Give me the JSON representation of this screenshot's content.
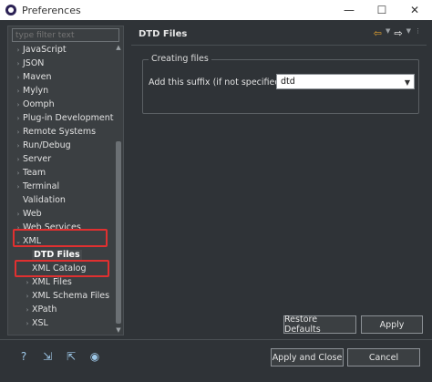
{
  "window": {
    "title": "Preferences",
    "minimize": "—",
    "maximize": "☐",
    "close": "✕"
  },
  "filter": {
    "placeholder": "type filter text"
  },
  "tree": {
    "items": [
      {
        "label": "JavaScript",
        "caret": "›"
      },
      {
        "label": "JSON",
        "caret": "›"
      },
      {
        "label": "Maven",
        "caret": "›"
      },
      {
        "label": "Mylyn",
        "caret": "›"
      },
      {
        "label": "Oomph",
        "caret": "›"
      },
      {
        "label": "Plug-in Development",
        "caret": "›"
      },
      {
        "label": "Remote Systems",
        "caret": "›"
      },
      {
        "label": "Run/Debug",
        "caret": "›"
      },
      {
        "label": "Server",
        "caret": "›"
      },
      {
        "label": "Team",
        "caret": "›"
      },
      {
        "label": "Terminal",
        "caret": "›"
      },
      {
        "label": "Validation",
        "caret": ""
      },
      {
        "label": "Web",
        "caret": "›"
      },
      {
        "label": "Web Services",
        "caret": "›"
      },
      {
        "label": "XML",
        "caret": "⌄"
      },
      {
        "label": "DTD Files",
        "caret": "",
        "child": true,
        "selected": true
      },
      {
        "label": "XML Catalog",
        "caret": "",
        "child": true
      },
      {
        "label": "XML Files",
        "caret": "›",
        "child": true
      },
      {
        "label": "XML Schema Files",
        "caret": "›",
        "child": true
      },
      {
        "label": "XPath",
        "caret": "›",
        "child": true
      },
      {
        "label": "XSL",
        "caret": "›",
        "child": true
      }
    ]
  },
  "page": {
    "title": "DTD Files",
    "group_label": "Creating files",
    "suffix_label": "Add this suffix (if not specified):",
    "suffix_value": "dtd"
  },
  "buttons": {
    "restore_defaults": "Restore Defaults",
    "apply": "Apply",
    "apply_and_close": "Apply and Close",
    "cancel": "Cancel"
  },
  "colors": {
    "background": "#2f3337",
    "highlight_box": "#e03030",
    "nav_arrow": "#e0a030"
  }
}
